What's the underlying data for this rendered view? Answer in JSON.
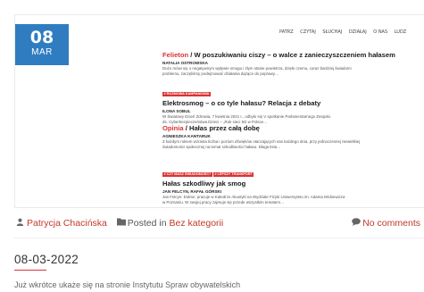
{
  "badge": {
    "day": "08",
    "month": "MAR"
  },
  "nav": {
    "items": [
      "PATRZ",
      "CZYTAJ",
      "SŁUCHAJ",
      "DZIAŁAJ",
      "O NAS",
      "LUDZ"
    ]
  },
  "articles": [
    {
      "title_red": "Felieton",
      "title_rest": " / W poszukiwaniu ciszy – o walce z zanieczyszczeniem hałasem",
      "author": "NATALIA OSTROWSKA",
      "text1": "Dużo mówi się o negatywnym wpływie smogu i złym stanie powietrza, dzięki czemu, coraz bardziej świadomi",
      "text2": "problemu, zaczęliśmy podejmować działania dążące do poprawy…"
    },
    {
      "tag": "# ROZMOWA KAMPANIOWA",
      "title": "Elektrosmog – o co tyle hałasu? Relacja z debaty",
      "author": "ILONA SOBUL",
      "text1": "W Światowy Dzień Zdrowia, 7 kwietnia 2021 r., odbyło się V spotkanie Parlamentarnego Zespołu",
      "text2": "ds. Cyberbezpieczeństwa Dzieci – „Rok sieci 5G w Polsce…"
    },
    {
      "title_red": "Opinia",
      "title_rest": " / Hałas przez całą dobę",
      "author": "AGNIESZKA KANTARUK",
      "text1": "Z każdym rokiem wzrasta liczba i poziom dźwięków otaczających nas każdego dnia, przy jednoczesnej niewielkiej",
      "text2": "świadomości społecznej na temat szkodliwości hałasu. Długa lista…"
    },
    {
      "tag1": "# CZY MASZ ŚWIADOMOŚĆ?",
      "tag2": "# LEPSZY TRANSPORT",
      "title": "Hałas szkodliwy jak smog",
      "author": "JAN FELCYN, RAFAŁ GÓRSKI",
      "text1": "Jan Felcyn: Doktor, pracuje w Katedrze Akustyki na Wydziale Fizyki Uniwersytetu im. Adama Mickiewicza",
      "text2": "w Poznaniu. W swojej pracy zajmuje się przede wszystkim tematem…"
    }
  ],
  "meta": {
    "author": "Patrycja Chacińska",
    "posted_in": "Posted in",
    "category": "Bez kategorii",
    "comments": "No comments"
  },
  "post": {
    "date": "08-03-2022",
    "excerpt": "Już wkrótce ukaże się na stronie Instytutu Spraw obywatelskich"
  },
  "colors": {
    "accent": "#2f7dc0",
    "red": "#d93333",
    "link": "#c0392b"
  }
}
